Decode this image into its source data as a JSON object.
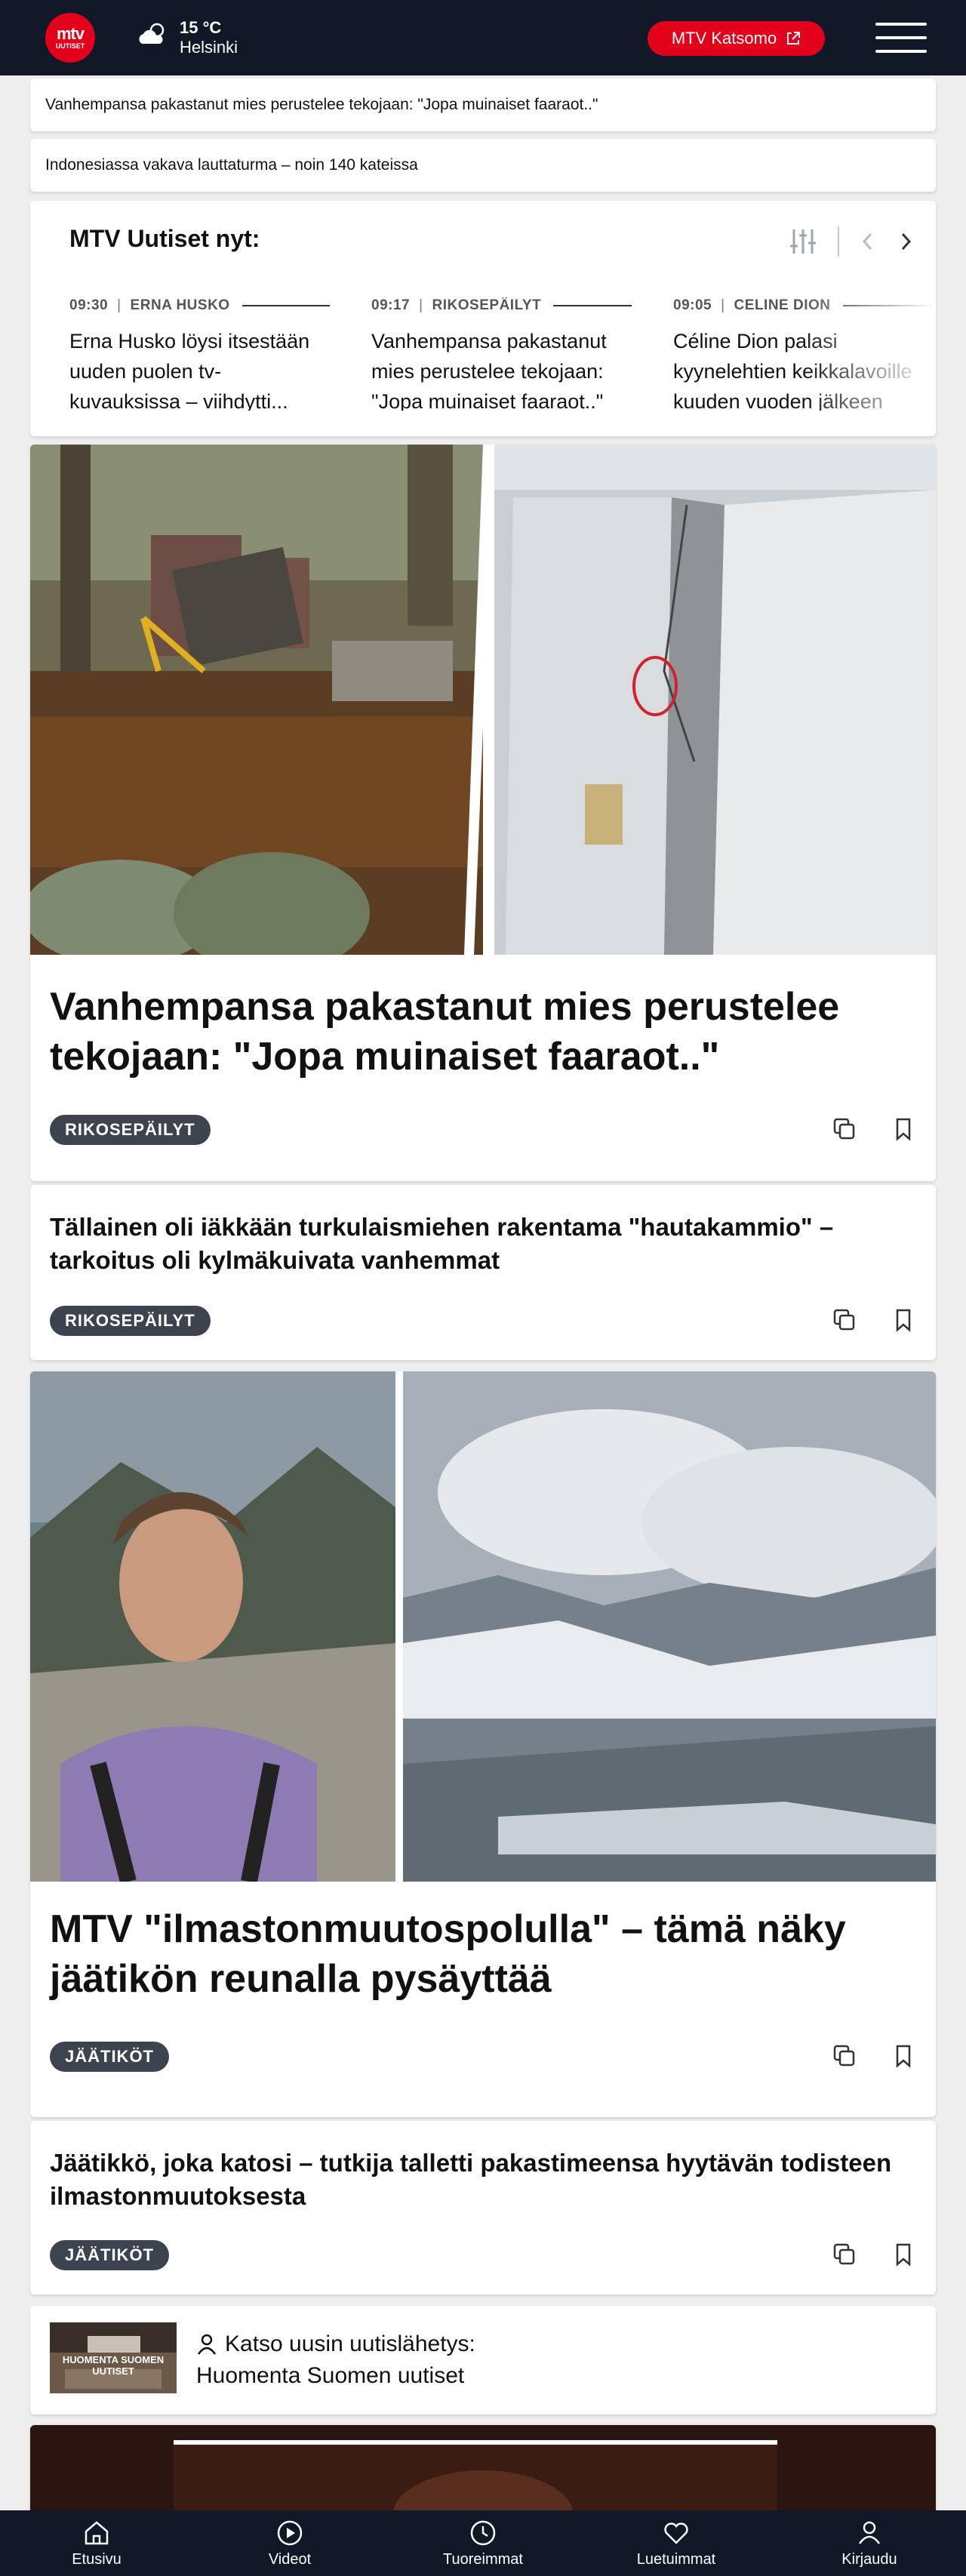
{
  "header": {
    "logo_top": "mtv",
    "logo_bottom": "UUTISET",
    "weather_temp": "15 °C",
    "weather_city": "Helsinki",
    "katsomo_label": "MTV Katsomo"
  },
  "tickers": [
    "Vanhempansa pakastanut mies perustelee tekojaan: \"Jopa muinaiset faaraot..\"",
    "Indonesiassa vakava lauttaturma – noin 140 kateissa"
  ],
  "now": {
    "title": "MTV Uutiset nyt:",
    "items": [
      {
        "time": "09:30",
        "category": "ERNA HUSKO",
        "headline": "Erna Husko löysi itsestään uuden puolen tv-kuvauksissa – viihdytti..."
      },
      {
        "time": "09:17",
        "category": "RIKOSEPÄILYT",
        "headline": "Vanhempansa pakastanut mies perustelee tekojaan: \"Jopa muinaiset faaraot..\""
      },
      {
        "time": "09:05",
        "category": "CELINE DION",
        "headline": "Céline Dion palasi kyynelehtien keikkalavoille kuuden vuoden jälkeen"
      }
    ]
  },
  "articles": [
    {
      "title": "Vanhempansa pakastanut mies perustelee tekojaan: \"Jopa muinaiset faaraot..\"",
      "tag": "RIKOSEPÄILYT"
    },
    {
      "title": "Tällainen oli iäkkään turkulaismiehen rakentama \"hautakammio\" – tarkoitus oli kylmäkuivata vanhemmat",
      "tag": "RIKOSEPÄILYT"
    },
    {
      "title": "MTV \"ilmastonmuutospolulla\" – tämä näky jäätikön reunalla pysäyttää",
      "tag": "JÄÄTIKÖT"
    },
    {
      "title": "Jäätikkö, joka katosi – tutkija talletti pakastimeensa hyytävän todisteen ilmastonmuutoksesta",
      "tag": "JÄÄTIKÖT"
    }
  ],
  "broadcast": {
    "thumb_label": "HUOMENTA SUOMEN UUTISET",
    "lead": "Katso uusin uutislähetys:",
    "title": "Huomenta Suomen uutiset"
  },
  "bottom_nav": [
    "Etusivu",
    "Videot",
    "Tuoreimmat",
    "Luetuimmat",
    "Kirjaudu"
  ]
}
